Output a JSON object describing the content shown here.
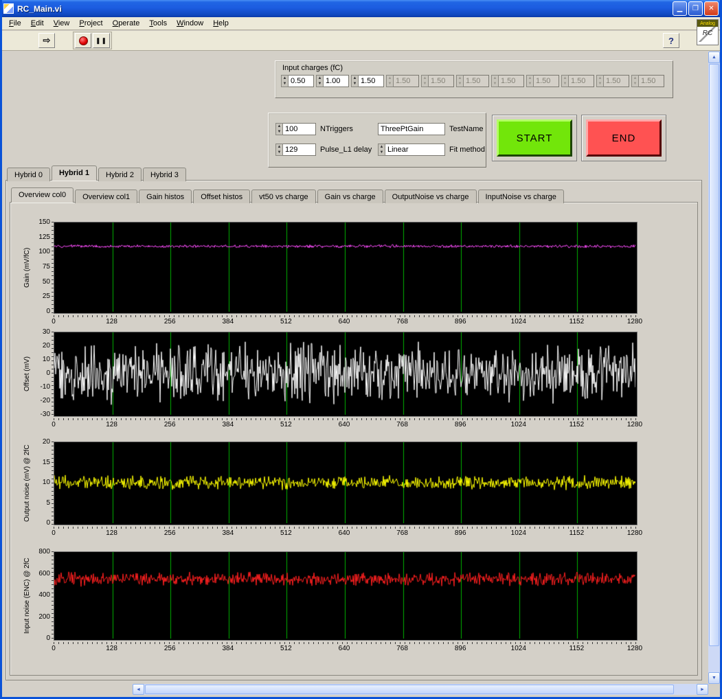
{
  "window": {
    "title": "RC_Main.vi"
  },
  "icons": {
    "minimize": "▁",
    "maximize": "❐",
    "close": "✕",
    "run": "⇨",
    "pause": "❚❚",
    "help": "?",
    "spin_up": "▲",
    "spin_down": "▼",
    "scroll_up": "▲",
    "scroll_down": "▼",
    "scroll_left": "◄",
    "scroll_right": "►"
  },
  "menu_bar": {
    "items": [
      "File",
      "Edit",
      "View",
      "Project",
      "Operate",
      "Tools",
      "Window",
      "Help"
    ]
  },
  "toolbar_badge": {
    "top": "Analog",
    "bottom": "RC"
  },
  "input_charges": {
    "title": "Input charges (fC)",
    "spinners": [
      {
        "value": "0.50",
        "enabled": true
      },
      {
        "value": "1.00",
        "enabled": true
      },
      {
        "value": "1.50",
        "enabled": true
      },
      {
        "value": "1.50",
        "enabled": false
      },
      {
        "value": "1.50",
        "enabled": false
      },
      {
        "value": "1.50",
        "enabled": false
      },
      {
        "value": "1.50",
        "enabled": false
      },
      {
        "value": "1.50",
        "enabled": false
      },
      {
        "value": "1.50",
        "enabled": false
      },
      {
        "value": "1.50",
        "enabled": false
      },
      {
        "value": "1.50",
        "enabled": false
      }
    ]
  },
  "test_controls": {
    "ntriggers": {
      "label": "NTriggers",
      "value": "100"
    },
    "pulse_l1_delay": {
      "label": "Pulse_L1 delay",
      "value": "129"
    },
    "test_name": {
      "label": "TestName",
      "value": "ThreePtGain"
    },
    "fit_method": {
      "label": "Fit method",
      "value": "Linear"
    },
    "start_label": "START",
    "end_label": "END"
  },
  "hybrid_tabs": {
    "active_index": 1,
    "items": [
      "Hybrid 0",
      "Hybrid 1",
      "Hybrid 2",
      "Hybrid 3"
    ]
  },
  "view_tabs": {
    "active_index": 0,
    "items": [
      "Overview col0",
      "Overview col1",
      "Gain histos",
      "Offset histos",
      "vt50 vs charge",
      "Gain vs charge",
      "OutputNoise vs charge",
      "InputNoise vs charge"
    ]
  },
  "chart_data": [
    {
      "type": "line",
      "ylabel": "Gain (mV/fC)",
      "ylim": [
        0,
        150
      ],
      "yticks": [
        150,
        125,
        100,
        75,
        50,
        25,
        0
      ],
      "xlim": [
        0,
        1280
      ],
      "xticks": [
        0,
        128,
        256,
        384,
        512,
        640,
        768,
        896,
        1024,
        1152,
        1280
      ],
      "grid_color": "#00b400",
      "grid_x_interval": 128,
      "series": [
        {
          "name": "Gain",
          "color": "#ff4dff",
          "baseline": 110,
          "amplitude": 2.5
        }
      ]
    },
    {
      "type": "line",
      "ylabel": "Offset (mV)",
      "ylim": [
        -30,
        30
      ],
      "yticks": [
        30,
        20,
        10,
        0,
        -10,
        -20,
        -30
      ],
      "xlim": [
        0,
        1280
      ],
      "xticks": [
        0,
        128,
        256,
        384,
        512,
        640,
        768,
        896,
        1024,
        1152,
        1280
      ],
      "grid_color": "#00b400",
      "grid_x_interval": 128,
      "series": [
        {
          "name": "Offset",
          "color": "#ffffff",
          "baseline": 0,
          "amplitude": 20
        }
      ]
    },
    {
      "type": "line",
      "ylabel": "Output noise (mV) @ 2fC",
      "ylim": [
        0,
        20
      ],
      "yticks": [
        20,
        15,
        10,
        5,
        0
      ],
      "xlim": [
        0,
        1280
      ],
      "xticks": [
        0,
        128,
        256,
        384,
        512,
        640,
        768,
        896,
        1024,
        1152,
        1280
      ],
      "grid_color": "#00b400",
      "grid_x_interval": 128,
      "series": [
        {
          "name": "OutputNoise",
          "color": "#ffff00",
          "baseline": 10,
          "amplitude": 1.6
        }
      ]
    },
    {
      "type": "line",
      "ylabel": "Input noise (ENC) @ 2fC",
      "ylim": [
        0,
        800
      ],
      "yticks": [
        800,
        600,
        400,
        200,
        0
      ],
      "xlim": [
        0,
        1280
      ],
      "xticks": [
        0,
        128,
        256,
        384,
        512,
        640,
        768,
        896,
        1024,
        1152,
        1280
      ],
      "grid_color": "#00b400",
      "grid_x_interval": 128,
      "series": [
        {
          "name": "InputNoise",
          "color": "#ff2020",
          "baseline": 550,
          "amplitude": 60
        }
      ]
    }
  ]
}
